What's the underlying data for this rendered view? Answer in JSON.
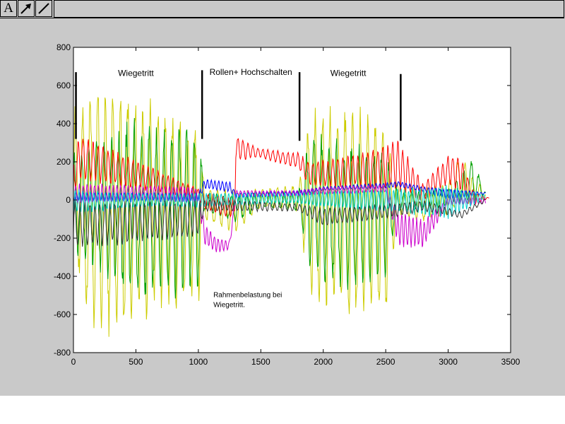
{
  "toolbar": {
    "text_tool": "A",
    "arrow_tool_icon": "arrow-icon",
    "line_tool_icon": "line-icon"
  },
  "colors": {
    "figure_bg": "#c9c9c9",
    "axes_bg": "#ffffff",
    "series": [
      "#cccc00",
      "#00a000",
      "#ff0000",
      "#0000ff",
      "#cc00cc",
      "#00cccc",
      "#333333"
    ]
  },
  "chart_data": {
    "type": "line",
    "title": "",
    "xlabel": "",
    "ylabel": "",
    "xlim": [
      0,
      3500
    ],
    "ylim": [
      -800,
      800
    ],
    "xticks": [
      0,
      500,
      1000,
      1500,
      2000,
      2500,
      3000,
      3500
    ],
    "yticks": [
      -800,
      -600,
      -400,
      -200,
      0,
      200,
      400,
      600,
      800
    ],
    "grid": false,
    "legend": "none",
    "annotations": [
      {
        "text": "Wiegetritt",
        "x": 500,
        "y": 650
      },
      {
        "text": "Rollen+ Hochschalten",
        "x": 1420,
        "y": 655
      },
      {
        "text": "Wiegetritt",
        "x": 2200,
        "y": 650
      }
    ],
    "note_lines": [
      "Rahmenbelastung bei",
      "Wiegetritt."
    ],
    "note_anchor": {
      "x": 1120,
      "y": -510
    },
    "markers": [
      {
        "x": 20,
        "y_top": 670,
        "y_bottom": 320
      },
      {
        "x": 1030,
        "y_top": 680,
        "y_bottom": 320
      },
      {
        "x": 1810,
        "y_top": 670,
        "y_bottom": 310
      },
      {
        "x": 2620,
        "y_top": 660,
        "y_bottom": 310
      }
    ],
    "series": [
      {
        "color": "#cccc00",
        "x": [
          0,
          150,
          500,
          1000,
          1050,
          1300,
          1500,
          1800,
          1900,
          2200,
          2500,
          2600,
          2800,
          3000,
          3100,
          3200,
          3300
        ],
        "y_max": [
          500,
          650,
          580,
          420,
          80,
          60,
          60,
          80,
          500,
          520,
          450,
          80,
          80,
          100,
          260,
          120,
          60
        ],
        "y_min": [
          -320,
          -780,
          -640,
          -580,
          -120,
          -180,
          -40,
          -60,
          -560,
          -640,
          -600,
          -80,
          -120,
          -80,
          -40,
          -20,
          0
        ],
        "period": 60
      },
      {
        "color": "#00a000",
        "x": [
          0,
          500,
          1000,
          1050,
          1300,
          1500,
          1800,
          1900,
          2200,
          2500,
          2600,
          3000,
          3200,
          3300
        ],
        "y_max": [
          280,
          450,
          400,
          40,
          30,
          40,
          40,
          380,
          320,
          300,
          40,
          60,
          220,
          40
        ],
        "y_min": [
          -280,
          -560,
          -500,
          -60,
          -120,
          -40,
          -60,
          -420,
          -500,
          -420,
          -60,
          -40,
          -20,
          30
        ],
        "period": 60
      },
      {
        "color": "#ff0000",
        "x": [
          0,
          50,
          1000,
          1050,
          1290,
          1300,
          1500,
          1800,
          1900,
          2200,
          2600,
          2800,
          3000,
          3100,
          3200,
          3330
        ],
        "y_max": [
          230,
          350,
          60,
          40,
          10,
          340,
          270,
          250,
          200,
          240,
          320,
          90,
          240,
          240,
          50,
          10
        ],
        "y_min": [
          0,
          100,
          0,
          -50,
          -110,
          200,
          220,
          160,
          60,
          60,
          40,
          -10,
          80,
          40,
          -30,
          10
        ],
        "period": 40
      },
      {
        "color": "#0000ff",
        "x": [
          0,
          500,
          1000,
          1050,
          1250,
          1300,
          1800,
          2000,
          2500,
          2600,
          2800,
          3000,
          3300
        ],
        "y_max": [
          40,
          40,
          40,
          110,
          100,
          40,
          50,
          70,
          90,
          100,
          70,
          60,
          40
        ],
        "y_min": [
          -10,
          -10,
          -10,
          60,
          40,
          10,
          20,
          50,
          60,
          70,
          40,
          0,
          30
        ],
        "period": 30
      },
      {
        "color": "#cc00cc",
        "x": [
          0,
          500,
          1000,
          1050,
          1150,
          1250,
          1300,
          1800,
          2000,
          2500,
          2600,
          2800,
          3000,
          3300
        ],
        "y_max": [
          90,
          80,
          70,
          -120,
          -200,
          -210,
          50,
          50,
          70,
          80,
          -50,
          -100,
          20,
          10
        ],
        "y_min": [
          -30,
          0,
          -20,
          -240,
          -280,
          -260,
          20,
          20,
          30,
          40,
          -250,
          -250,
          -30,
          -20
        ],
        "period": 30
      },
      {
        "color": "#00cccc",
        "x": [
          0,
          500,
          1000,
          1300,
          1800,
          2000,
          2500,
          3000,
          3300
        ],
        "y_max": [
          60,
          40,
          40,
          40,
          40,
          50,
          60,
          80,
          30
        ],
        "y_min": [
          -80,
          -40,
          -40,
          -30,
          -20,
          -40,
          -60,
          -110,
          10
        ],
        "period": 30
      },
      {
        "color": "#333333",
        "x": [
          0,
          500,
          1000,
          1050,
          1300,
          1800,
          2000,
          2500,
          2800,
          3000,
          3100,
          3300
        ],
        "y_max": [
          0,
          0,
          0,
          0,
          0,
          -20,
          -40,
          -20,
          0,
          -40,
          -60,
          10
        ],
        "y_min": [
          -260,
          -230,
          -200,
          -60,
          -60,
          -60,
          -140,
          -100,
          -60,
          -80,
          -100,
          -10
        ],
        "period": 40
      }
    ]
  }
}
